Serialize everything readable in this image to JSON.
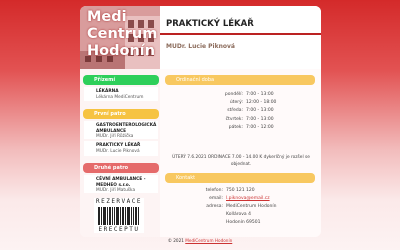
{
  "brand": {
    "line1": "Medi",
    "line2": "Centrum",
    "line3": "Hodonín"
  },
  "header": {
    "title": "PRAKTICKÝ LÉKAŘ",
    "doctor": "MUDr. Lucie Piknová"
  },
  "sidebar": {
    "sections": [
      {
        "title": "Přízemí",
        "color": "#2ecf5a",
        "items": [
          {
            "name": "LÉKÁRNA",
            "sub": "Lékárna MediCentrum"
          }
        ]
      },
      {
        "title": "První patro",
        "color": "#f6c342",
        "items": [
          {
            "name": "GASTROENTEROLOGICKÁ AMBULANCE",
            "sub": "MUDr. Jiří Růžička"
          },
          {
            "name": "PRAKTICKÝ LÉKAŘ",
            "sub": "MUDr. Lucie Piknová"
          }
        ]
      },
      {
        "title": "Druhé patro",
        "color": "#e56a6a",
        "items": [
          {
            "name": "CÉVNÍ AMBULANCE - MEDHEO s.r.o.",
            "sub": "MUDr. Jiří Matuška"
          }
        ]
      }
    ]
  },
  "barcode": {
    "top": "REZERVACE",
    "bottom": "ERECEPTU"
  },
  "main": {
    "hours_title": "Ordinační doba",
    "hours": [
      {
        "day": "pondělí:",
        "time": "7:00 - 13:00"
      },
      {
        "day": "úterý:",
        "time": "12:00 - 18:00"
      },
      {
        "day": "středa:",
        "time": "7:00 - 13:00"
      },
      {
        "day": "čtvrtek:",
        "time": "7:00 - 13:00"
      },
      {
        "day": "pátek:",
        "time": "7:00 - 12:00"
      }
    ],
    "notice_line1": "ÚTERÝ 7.6.2021 ORDINACE 7.00 - 14.00 K dykerlčný je rozšel se",
    "notice_line2": "objednat.",
    "contact_title": "Kontakt",
    "contact": [
      {
        "label": "telefon:",
        "value": "750 121 120"
      },
      {
        "label": "email:",
        "value": "l.piknova@email.cz"
      },
      {
        "label": "adresa:",
        "value": "MediCentrum Hodonín"
      },
      {
        "label": "",
        "value": "Kollárova 4"
      },
      {
        "label": "",
        "value": "Hodonín 69501"
      }
    ]
  },
  "footer": {
    "prefix": "© 2021",
    "link": "MediCentrum Hodonín"
  }
}
